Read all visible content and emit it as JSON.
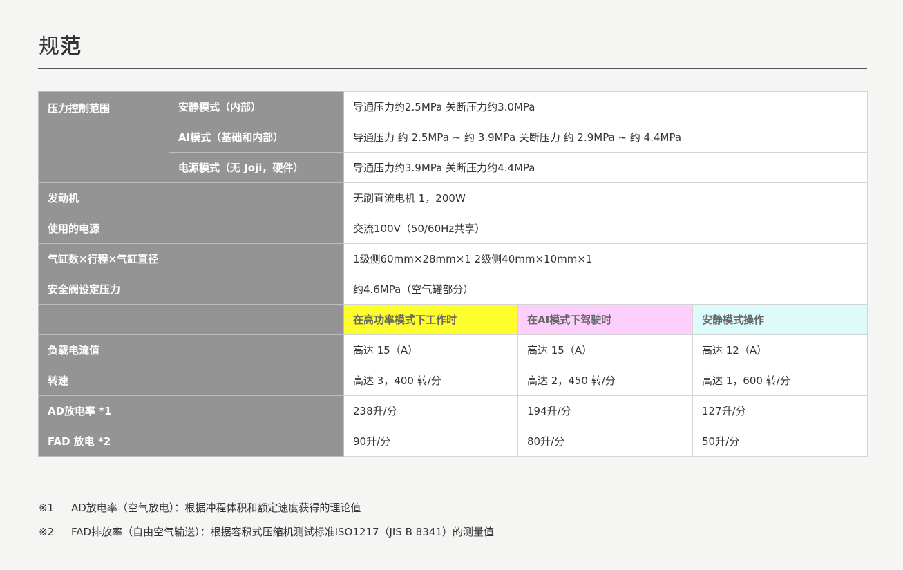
{
  "title": {
    "part1": "规",
    "part2": "范"
  },
  "rows": {
    "pressure": {
      "label": "压力控制范围",
      "quiet": {
        "label": "安静模式（内部）",
        "value": "导通压力约2.5MPa 关断压力约3.0MPa"
      },
      "ai": {
        "label": "AI模式（基础和内部）",
        "value": "导通压力 约 2.5MPa ~ 约 3.9MPa 关断压力 约 2.9MPa ~ 约 4.4MPa"
      },
      "power": {
        "label": "电源模式（无 Joji，硬件）",
        "value": "导通压力约3.9MPa 关断压力约4.4MPa"
      }
    },
    "motor": {
      "label": "发动机",
      "value": "无刷直流电机 1，200W"
    },
    "supply": {
      "label": "使用的电源",
      "value": "交流100V（50/60Hz共享）"
    },
    "cylinder": {
      "label": "气缸数×行程×气缸直径",
      "value": "1级侧60mm×28mm×1 2级侧40mm×10mm×1"
    },
    "safety": {
      "label": "安全阀设定压力",
      "value": "约4.6MPa（空气罐部分）"
    },
    "modes": [
      "在高功率模式下工作时",
      "在AI模式下驾驶时",
      "安静模式操作"
    ],
    "current": {
      "label": "负载电流值",
      "values": [
        "高达 15（A）",
        "高达 15（A）",
        "高达 12（A）"
      ]
    },
    "speed": {
      "label": "转速",
      "values": [
        "高达 3，400 转/分",
        "高达 2，450 转/分",
        "高达 1，600 转/分"
      ]
    },
    "ad": {
      "label": "AD放电率 *1",
      "values": [
        "238升/分",
        "194升/分",
        "127升/分"
      ]
    },
    "fad": {
      "label": "FAD 放电 *2",
      "values": [
        "90升/分",
        "80升/分",
        "50升/分"
      ]
    }
  },
  "mode_colors": [
    "#fefe2e",
    "#fccffc",
    "#dcfbfb"
  ],
  "notes": [
    {
      "mark": "※1",
      "text": "AD放电率（空气放电）：根据冲程体积和额定速度获得的理论值"
    },
    {
      "mark": "※2",
      "text": "FAD排放率（自由空气输送）：根据容积式压缩机测试标准ISO1217（JIS B 8341）的测量值"
    }
  ]
}
